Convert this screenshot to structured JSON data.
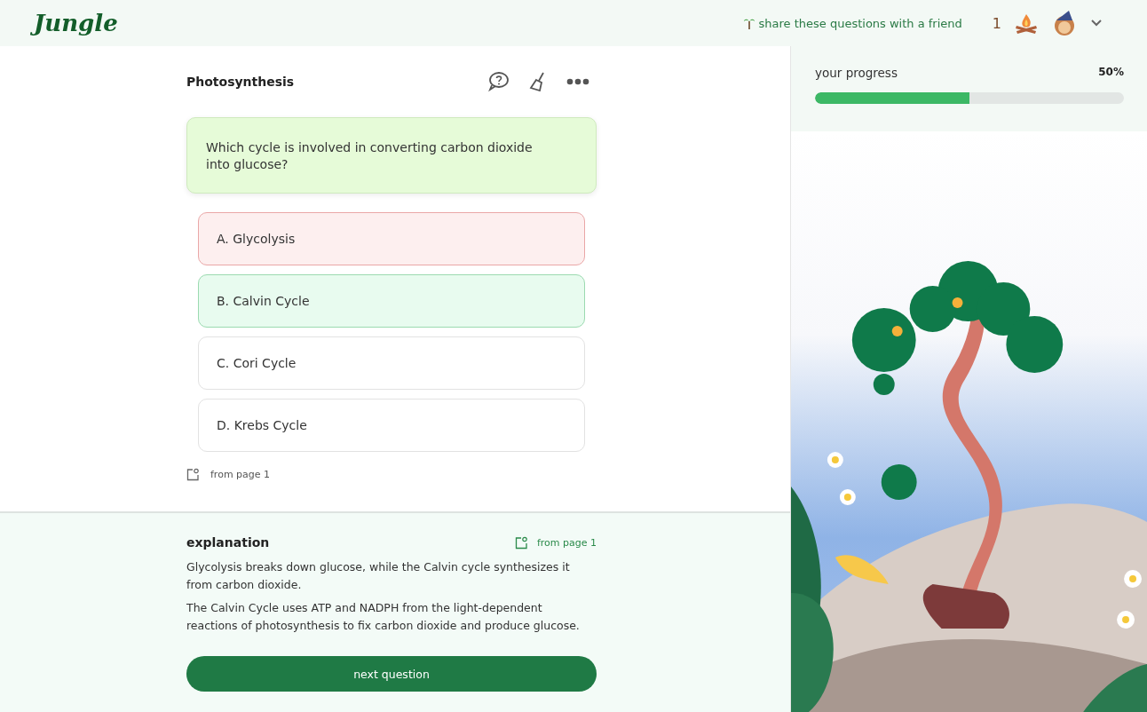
{
  "header": {
    "logo": "Jungle",
    "share_link": "share these questions with a friend",
    "streak_count": "1"
  },
  "quiz": {
    "title": "Photosynthesis",
    "question": "Which cycle is involved in converting carbon dioxide into glucose?",
    "options": [
      {
        "label": "A. Glycolysis",
        "kind": "incorrect"
      },
      {
        "label": "B. Calvin Cycle",
        "kind": "correct"
      },
      {
        "label": "C. Cori Cycle",
        "kind": "plain"
      },
      {
        "label": "D. Krebs Cycle",
        "kind": "plain"
      }
    ],
    "source": "from page 1"
  },
  "explanation": {
    "title": "explanation",
    "source": "from page 1",
    "paragraphs": [
      "Glycolysis breaks down glucose, while the Calvin cycle synthesizes it from carbon dioxide.",
      "The Calvin Cycle uses ATP and NADPH from the light-dependent reactions of photosynthesis to fix carbon dioxide and produce glucose."
    ],
    "button": "next question"
  },
  "progress": {
    "label": "your progress",
    "reading": "50%",
    "level": 0.5
  }
}
